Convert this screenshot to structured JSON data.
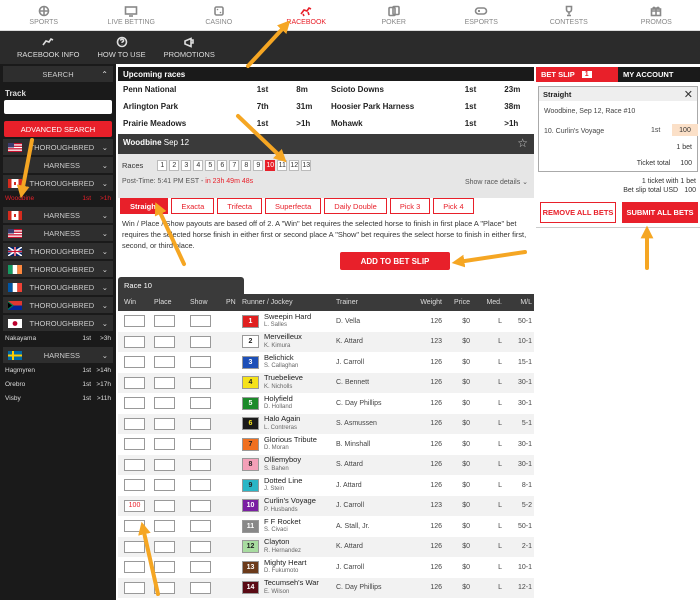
{
  "nav": {
    "items": [
      {
        "label": "SPORTS",
        "icon": "sports-icon"
      },
      {
        "label": "LIVE BETTING",
        "icon": "live-betting-icon"
      },
      {
        "label": "CASINO",
        "icon": "casino-icon"
      },
      {
        "label": "RACEBOOK",
        "icon": "racebook-icon"
      },
      {
        "label": "POKER",
        "icon": "poker-icon"
      },
      {
        "label": "ESPORTS",
        "icon": "esports-icon"
      },
      {
        "label": "CONTESTS",
        "icon": "trophy-icon"
      },
      {
        "label": "PROMOS",
        "icon": "gift-icon"
      }
    ],
    "active": "RACEBOOK",
    "accent_color": "#e8202a"
  },
  "subnav": {
    "items": [
      {
        "label": "RACEBOOK INFO",
        "icon": "racebook-info-icon"
      },
      {
        "label": "HOW TO USE",
        "icon": "question-icon"
      },
      {
        "label": "PROMOTIONS",
        "icon": "promotions-icon"
      }
    ]
  },
  "sidebar": {
    "search_label": "SEARCH",
    "track_label": "Track",
    "track_value": "",
    "advanced_search_label": "ADVANCED SEARCH",
    "groups": [
      {
        "flag": "us",
        "label": "THOROUGHBRED",
        "races": []
      },
      {
        "flag": "none",
        "label": "HARNESS",
        "races": []
      },
      {
        "flag": "ca",
        "label": "THOROUGHBRED",
        "races": [
          {
            "name": "Woodbine",
            "n": "1st",
            "t": ">1h",
            "selected": true
          }
        ]
      },
      {
        "flag": "ca",
        "label": "HARNESS",
        "races": []
      },
      {
        "flag": "us",
        "label": "HARNESS",
        "races": []
      },
      {
        "flag": "gb",
        "label": "THOROUGHBRED",
        "races": []
      },
      {
        "flag": "ie",
        "label": "THOROUGHBRED",
        "races": []
      },
      {
        "flag": "fr",
        "label": "THOROUGHBRED",
        "races": []
      },
      {
        "flag": "za",
        "label": "THOROUGHBRED",
        "races": []
      },
      {
        "flag": "jp",
        "label": "THOROUGHBRED",
        "races": [
          {
            "name": "Nakayama",
            "n": "1st",
            "t": ">3h",
            "selected": false
          }
        ]
      },
      {
        "flag": "se",
        "label": "HARNESS",
        "races": [
          {
            "name": "Hagmyren",
            "n": "1st",
            "t": ">14h",
            "selected": false
          },
          {
            "name": "Orebro",
            "n": "1st",
            "t": ">17h",
            "selected": false
          },
          {
            "name": "Visby",
            "n": "1st",
            "t": ">11h",
            "selected": false
          }
        ]
      }
    ]
  },
  "upcoming": {
    "title": "Upcoming races",
    "rows": [
      [
        "Penn National",
        "1st",
        "8m",
        "Scioto Downs",
        "1st",
        "23m"
      ],
      [
        "Arlington Park",
        "7th",
        "31m",
        "Hoosier Park Harness",
        "1st",
        "38m"
      ],
      [
        "Prairie Meadows",
        "1st",
        ">1h",
        "Mohawk",
        "1st",
        ">1h"
      ]
    ]
  },
  "meet": {
    "title": "Woodbine",
    "date": "Sep 12",
    "races_label": "Races",
    "races": [
      "1",
      "2",
      "3",
      "4",
      "5",
      "6",
      "7",
      "8",
      "9",
      "10",
      "11",
      "12",
      "13"
    ],
    "active_race": "10",
    "post_time_label": "Post-Time: 5:41 PM EST -",
    "post_time_countdown": "in 23h 49m 48s",
    "show_details": "Show race details ⌄"
  },
  "bet_types": {
    "tabs": [
      "Straight",
      "Exacta",
      "Trifecta",
      "Superfecta",
      "Daily Double",
      "Pick 3",
      "Pick 4"
    ],
    "active": "Straight",
    "description": "Win / Place / Show payouts are based off of 2. A \"Win\" bet requires the selected horse to finish in first place A \"Place\" bet requires the selected horse finish in either first or second place A \"Show\" bet requires the select horse to finish in either first, second, or third place.",
    "add_label": "ADD TO BET SLIP"
  },
  "runners": {
    "race_label": "Race 10",
    "headers": {
      "win": "Win",
      "place": "Place",
      "show": "Show",
      "pn": "PN",
      "runner": "Runner / Jockey",
      "trainer": "Trainer",
      "weight": "Weight",
      "price": "Price",
      "med": "Med.",
      "ml": "M/L"
    },
    "rows": [
      {
        "pn": "1",
        "horse": "Sweepin Hard",
        "jockey": "L. Salles",
        "trainer": "D. Vella",
        "weight": "126",
        "price": "$0",
        "med": "L",
        "ml": "50-1",
        "win": "",
        "bg": "#e02020",
        "fg": "#ffffff"
      },
      {
        "pn": "2",
        "horse": "Merveilleux",
        "jockey": "K. Kimura",
        "trainer": "K. Attard",
        "weight": "123",
        "price": "$0",
        "med": "L",
        "ml": "10-1",
        "win": "",
        "bg": "#ffffff",
        "fg": "#222222"
      },
      {
        "pn": "3",
        "horse": "Belichick",
        "jockey": "S. Callaghan",
        "trainer": "J. Carroll",
        "weight": "126",
        "price": "$0",
        "med": "L",
        "ml": "15-1",
        "win": "",
        "bg": "#1d4fb8",
        "fg": "#ffffff"
      },
      {
        "pn": "4",
        "horse": "Truebelieve",
        "jockey": "K. Nicholls",
        "trainer": "C. Bennett",
        "weight": "126",
        "price": "$0",
        "med": "L",
        "ml": "30-1",
        "win": "",
        "bg": "#f5e21a",
        "fg": "#222222"
      },
      {
        "pn": "5",
        "horse": "Holyfield",
        "jockey": "D. Holland",
        "trainer": "C. Day Phillips",
        "weight": "126",
        "price": "$0",
        "med": "L",
        "ml": "30-1",
        "win": "",
        "bg": "#1c8a2a",
        "fg": "#ffffff"
      },
      {
        "pn": "6",
        "horse": "Halo Again",
        "jockey": "L. Contreras",
        "trainer": "S. Asmussen",
        "weight": "126",
        "price": "$0",
        "med": "L",
        "ml": "5-1",
        "win": "",
        "bg": "#1a1a1a",
        "fg": "#f5e21a"
      },
      {
        "pn": "7",
        "horse": "Glorious Tribute",
        "jockey": "D. Moran",
        "trainer": "B. Minshall",
        "weight": "126",
        "price": "$0",
        "med": "L",
        "ml": "30-1",
        "win": "",
        "bg": "#f07020",
        "fg": "#222222"
      },
      {
        "pn": "8",
        "horse": "Olliemyboy",
        "jockey": "S. Bahen",
        "trainer": "S. Attard",
        "weight": "126",
        "price": "$0",
        "med": "L",
        "ml": "30-1",
        "win": "",
        "bg": "#f4a0b8",
        "fg": "#222222"
      },
      {
        "pn": "9",
        "horse": "Dotted Line",
        "jockey": "J. Stein",
        "trainer": "J. Attard",
        "weight": "126",
        "price": "$0",
        "med": "L",
        "ml": "8-1",
        "win": "",
        "bg": "#29b6c6",
        "fg": "#222222"
      },
      {
        "pn": "10",
        "horse": "Curlin's Voyage",
        "jockey": "P. Husbands",
        "trainer": "J. Carroll",
        "weight": "123",
        "price": "$0",
        "med": "L",
        "ml": "5-2",
        "win": "100",
        "bg": "#7a1fa2",
        "fg": "#ffffff"
      },
      {
        "pn": "11",
        "horse": "F F Rocket",
        "jockey": "S. Civaci",
        "trainer": "A. Stall, Jr.",
        "weight": "126",
        "price": "$0",
        "med": "L",
        "ml": "50-1",
        "win": "",
        "bg": "#888888",
        "fg": "#ffffff"
      },
      {
        "pn": "12",
        "horse": "Clayton",
        "jockey": "R. Hernandez",
        "trainer": "K. Attard",
        "weight": "126",
        "price": "$0",
        "med": "L",
        "ml": "2-1",
        "win": "",
        "bg": "#a8dca0",
        "fg": "#222222"
      },
      {
        "pn": "13",
        "horse": "Mighty Heart",
        "jockey": "D. Fukumoto",
        "trainer": "J. Carroll",
        "weight": "126",
        "price": "$0",
        "med": "L",
        "ml": "10-1",
        "win": "",
        "bg": "#6b3a1a",
        "fg": "#ffffff"
      },
      {
        "pn": "14",
        "horse": "Tecumseh's War",
        "jockey": "E. Wilson",
        "trainer": "C. Day Phillips",
        "weight": "126",
        "price": "$0",
        "med": "L",
        "ml": "12-1",
        "win": "",
        "bg": "#5a0a14",
        "fg": "#ffffff"
      }
    ]
  },
  "betslip": {
    "tab_label": "BET SLIP",
    "count": "1",
    "account_label": "MY ACCOUNT",
    "card_title": "Straight",
    "race": "Woodbine, Sep 12, Race #10",
    "selection": "10. Curlin's Voyage",
    "position": "1st",
    "amount": "100",
    "bets_line": "1 bet",
    "ticket_total_label": "Ticket total",
    "ticket_total_value": "100",
    "summary_line1": "1 ticket with 1 bet",
    "summary_total_label": "Bet slip total USD",
    "summary_total_value": "100",
    "remove_label": "REMOVE ALL BETS",
    "submit_label": "SUBMIT ALL BETS"
  }
}
